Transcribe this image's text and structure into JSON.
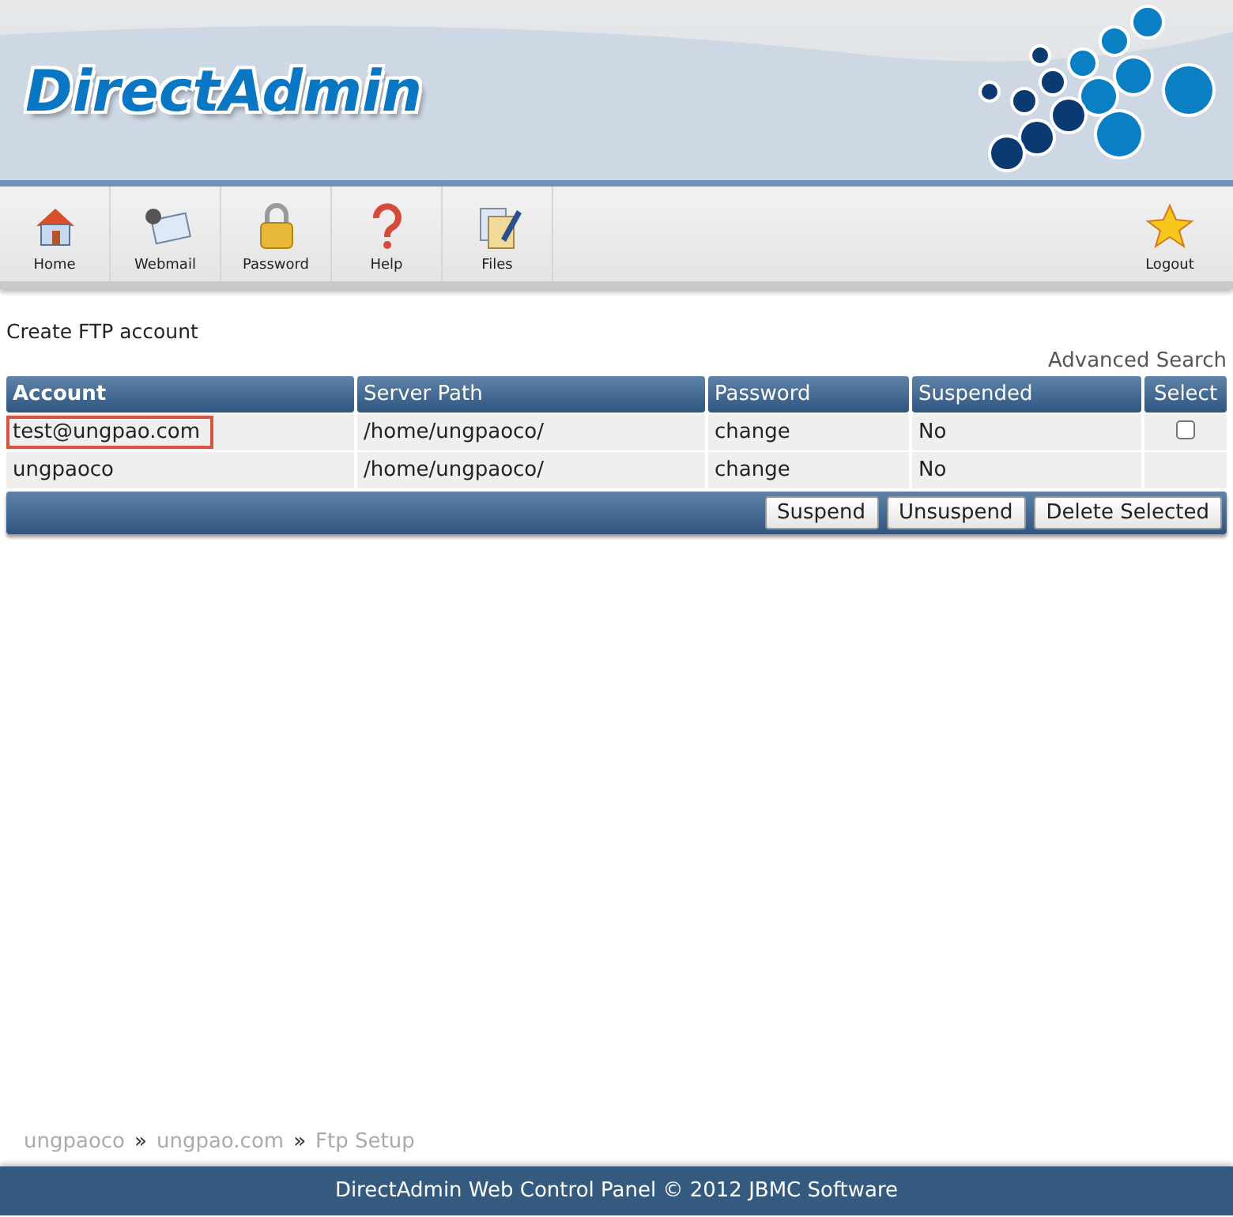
{
  "header": {
    "logo": "DirectAdmin"
  },
  "toolbar": {
    "items": [
      {
        "kind": "home",
        "label": "Home"
      },
      {
        "kind": "webmail",
        "label": "Webmail"
      },
      {
        "kind": "password",
        "label": "Password"
      },
      {
        "kind": "help",
        "label": "Help"
      },
      {
        "kind": "files",
        "label": "Files"
      }
    ],
    "logout": {
      "kind": "logout",
      "label": "Logout"
    }
  },
  "create_link": "Create FTP account",
  "advanced_search": "Advanced Search",
  "table": {
    "columns": [
      "Account",
      "Server Path",
      "Password",
      "Suspended",
      "Select"
    ],
    "rows": [
      {
        "account": "test@ungpao.com",
        "highlighted": true,
        "path": "/home/ungpaoco/",
        "password": "change",
        "suspended": "No",
        "select": {
          "checked": false
        }
      },
      {
        "account": "ungpaoco",
        "highlighted": false,
        "path": "/home/ungpaoco/",
        "password": "change",
        "suspended": "No"
      }
    ],
    "buttons": [
      "Suspend",
      "Unsuspend",
      "Delete Selected"
    ]
  },
  "breadcrumb": [
    {
      "kind": "link",
      "text": "ungpaoco"
    },
    {
      "kind": "sep",
      "text": "»"
    },
    {
      "kind": "link",
      "text": "ungpao.com"
    },
    {
      "kind": "sep",
      "text": "»"
    },
    {
      "kind": "current",
      "text": "Ftp Setup"
    }
  ],
  "footer": "DirectAdmin Web Control Panel © 2012 JBMC Software"
}
